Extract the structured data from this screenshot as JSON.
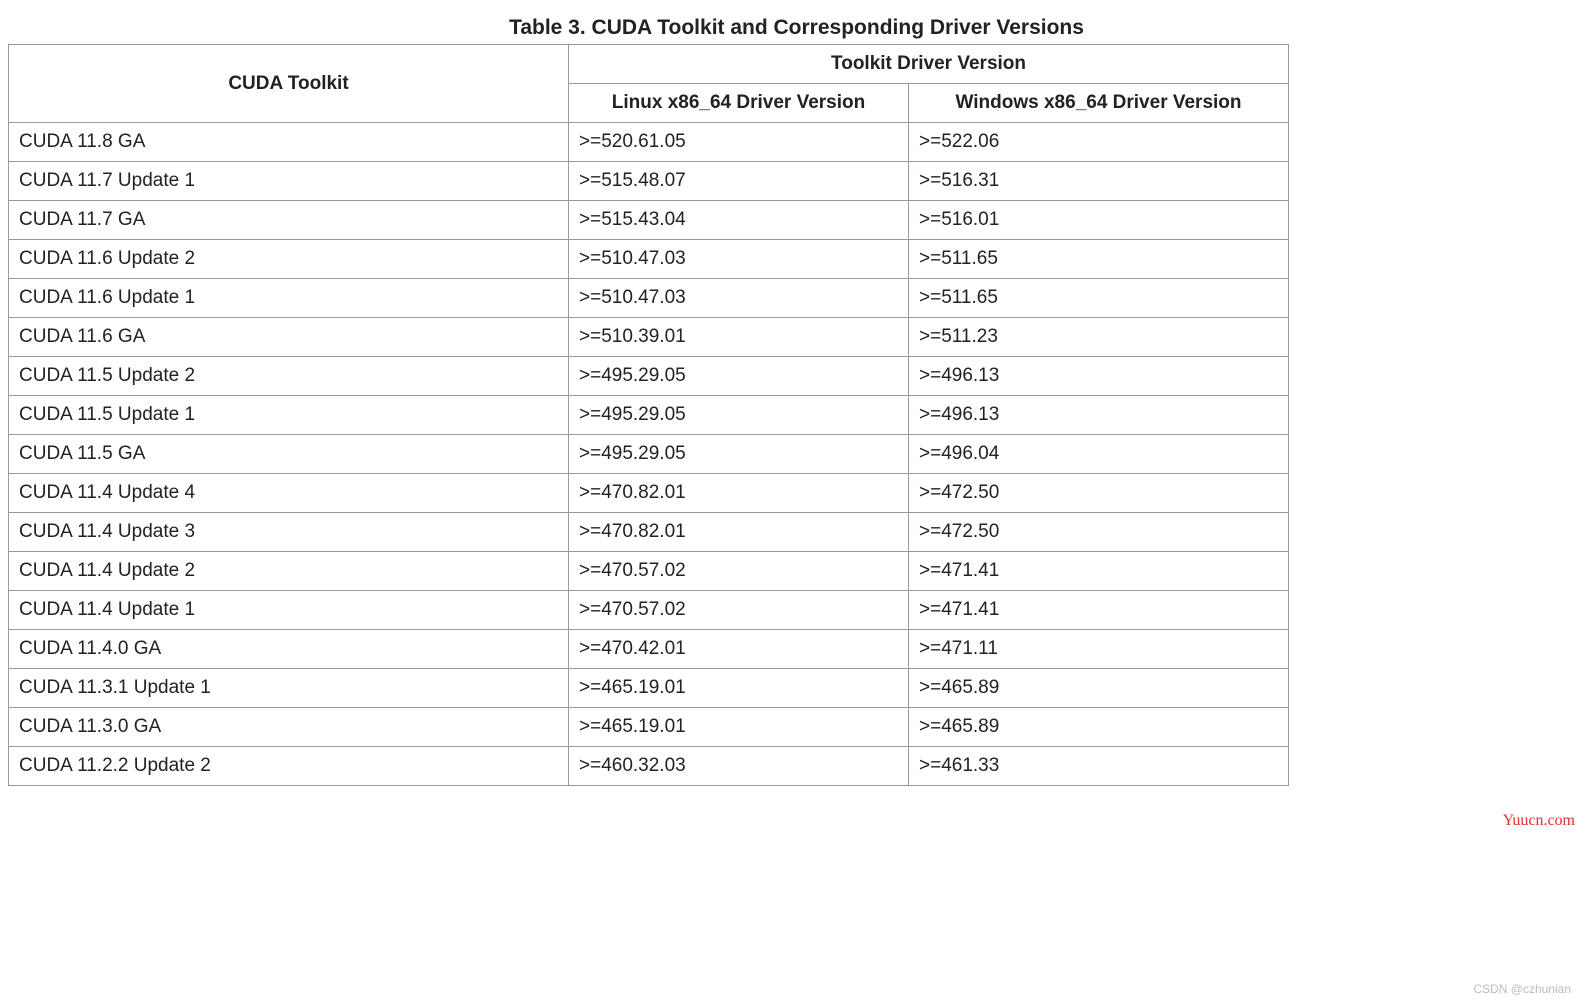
{
  "title": "Table 3. CUDA Toolkit and Corresponding Driver Versions",
  "headers": {
    "toolkit": "CUDA Toolkit",
    "driver_version": "Toolkit Driver Version",
    "linux": "Linux x86_64 Driver Version",
    "windows": "Windows x86_64 Driver Version"
  },
  "rows": [
    {
      "toolkit": "CUDA 11.8 GA",
      "linux": ">=520.61.05",
      "windows": ">=522.06"
    },
    {
      "toolkit": "CUDA 11.7 Update 1",
      "linux": ">=515.48.07",
      "windows": ">=516.31"
    },
    {
      "toolkit": "CUDA 11.7 GA",
      "linux": ">=515.43.04",
      "windows": ">=516.01"
    },
    {
      "toolkit": "CUDA 11.6 Update 2",
      "linux": ">=510.47.03",
      "windows": ">=511.65"
    },
    {
      "toolkit": "CUDA 11.6 Update 1",
      "linux": ">=510.47.03",
      "windows": ">=511.65"
    },
    {
      "toolkit": "CUDA 11.6 GA",
      "linux": ">=510.39.01",
      "windows": ">=511.23"
    },
    {
      "toolkit": "CUDA 11.5 Update 2",
      "linux": ">=495.29.05",
      "windows": ">=496.13"
    },
    {
      "toolkit": "CUDA 11.5 Update 1",
      "linux": ">=495.29.05",
      "windows": ">=496.13"
    },
    {
      "toolkit": "CUDA 11.5 GA",
      "linux": ">=495.29.05",
      "windows": ">=496.04"
    },
    {
      "toolkit": "CUDA 11.4 Update 4",
      "linux": ">=470.82.01",
      "windows": ">=472.50"
    },
    {
      "toolkit": "CUDA 11.4 Update 3",
      "linux": ">=470.82.01",
      "windows": ">=472.50"
    },
    {
      "toolkit": "CUDA 11.4 Update 2",
      "linux": ">=470.57.02",
      "windows": ">=471.41"
    },
    {
      "toolkit": "CUDA 11.4 Update 1",
      "linux": ">=470.57.02",
      "windows": ">=471.41"
    },
    {
      "toolkit": "CUDA 11.4.0 GA",
      "linux": ">=470.42.01",
      "windows": ">=471.11"
    },
    {
      "toolkit": "CUDA 11.3.1 Update 1",
      "linux": ">=465.19.01",
      "windows": ">=465.89"
    },
    {
      "toolkit": "CUDA 11.3.0 GA",
      "linux": ">=465.19.01",
      "windows": ">=465.89"
    },
    {
      "toolkit": "CUDA 11.2.2 Update 2",
      "linux": ">=460.32.03",
      "windows": ">=461.33"
    }
  ],
  "watermarks": {
    "yuucn": "Yuucn.com",
    "csdn": "CSDN @czhunian"
  },
  "chart_data": {
    "type": "table",
    "title": "Table 3. CUDA Toolkit and Corresponding Driver Versions",
    "columns": [
      "CUDA Toolkit",
      "Linux x86_64 Driver Version",
      "Windows x86_64 Driver Version"
    ],
    "rows": [
      [
        "CUDA 11.8 GA",
        ">=520.61.05",
        ">=522.06"
      ],
      [
        "CUDA 11.7 Update 1",
        ">=515.48.07",
        ">=516.31"
      ],
      [
        "CUDA 11.7 GA",
        ">=515.43.04",
        ">=516.01"
      ],
      [
        "CUDA 11.6 Update 2",
        ">=510.47.03",
        ">=511.65"
      ],
      [
        "CUDA 11.6 Update 1",
        ">=510.47.03",
        ">=511.65"
      ],
      [
        "CUDA 11.6 GA",
        ">=510.39.01",
        ">=511.23"
      ],
      [
        "CUDA 11.5 Update 2",
        ">=495.29.05",
        ">=496.13"
      ],
      [
        "CUDA 11.5 Update 1",
        ">=495.29.05",
        ">=496.13"
      ],
      [
        "CUDA 11.5 GA",
        ">=495.29.05",
        ">=496.04"
      ],
      [
        "CUDA 11.4 Update 4",
        ">=470.82.01",
        ">=472.50"
      ],
      [
        "CUDA 11.4 Update 3",
        ">=470.82.01",
        ">=472.50"
      ],
      [
        "CUDA 11.4 Update 2",
        ">=470.57.02",
        ">=471.41"
      ],
      [
        "CUDA 11.4 Update 1",
        ">=470.57.02",
        ">=471.41"
      ],
      [
        "CUDA 11.4.0 GA",
        ">=470.42.01",
        ">=471.11"
      ],
      [
        "CUDA 11.3.1 Update 1",
        ">=465.19.01",
        ">=465.89"
      ],
      [
        "CUDA 11.3.0 GA",
        ">=465.19.01",
        ">=465.89"
      ],
      [
        "CUDA 11.2.2 Update 2",
        ">=460.32.03",
        ">=461.33"
      ]
    ]
  }
}
